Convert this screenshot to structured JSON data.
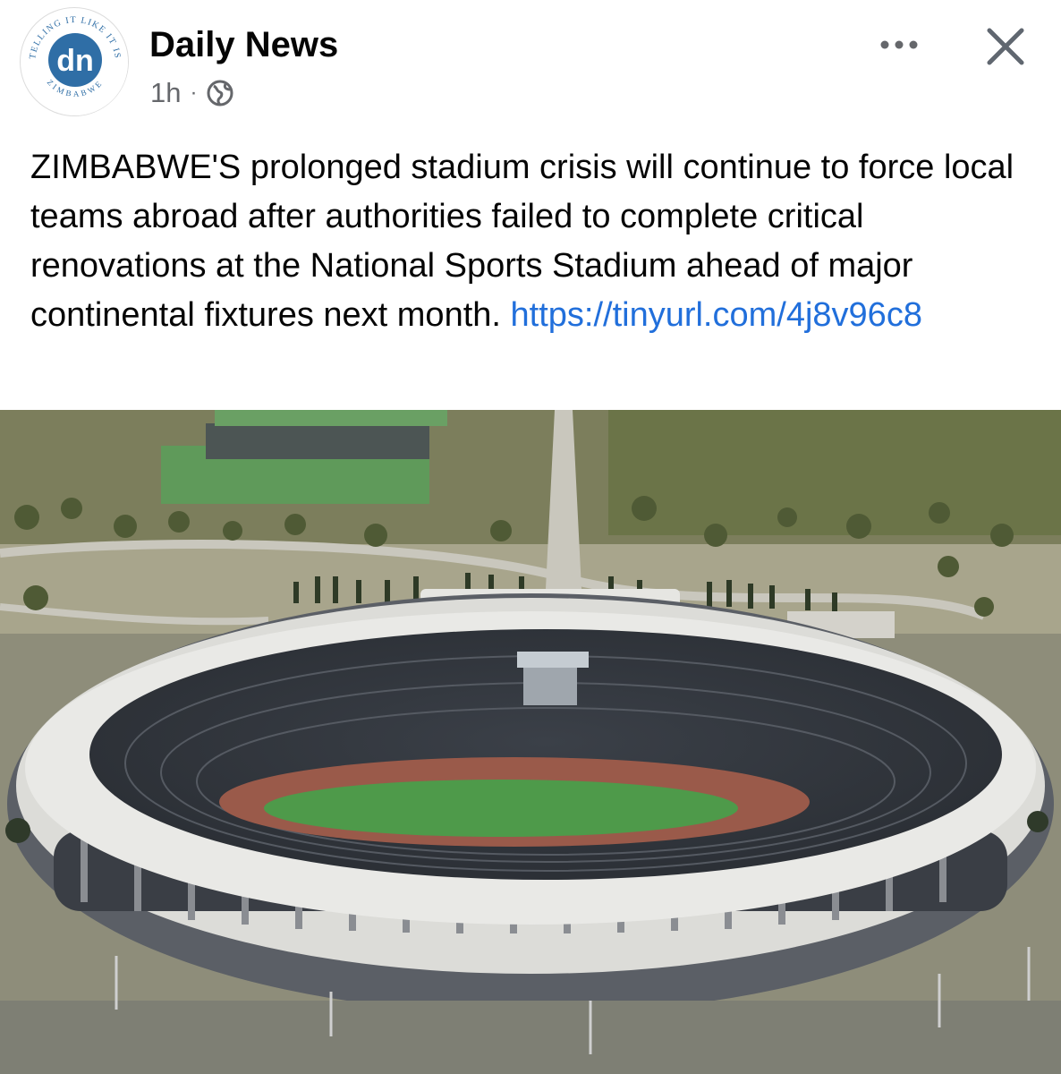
{
  "post": {
    "page_name": "Daily News",
    "timestamp": "1h",
    "separator": "·",
    "audience_icon": "globe-icon",
    "logo": {
      "initials": "dn",
      "ring_text_top": "TELLING IT LIKE IT IS",
      "ring_text_bottom": "ZIMBABWE",
      "accent_color": "#2f6ea6"
    },
    "more_icon": "more-dots-icon",
    "close_icon": "close-icon",
    "text": "ZIMBABWE'S prolonged stadium crisis will continue to force local teams abroad after authorities failed to complete critical renovations at the National Sports Stadium ahead of major continental fixtures next month.",
    "link": "https://tinyurl.com/4j8v96c8",
    "link_color": "#216fdb",
    "image_subject": "aerial view of National Sports Stadium"
  }
}
